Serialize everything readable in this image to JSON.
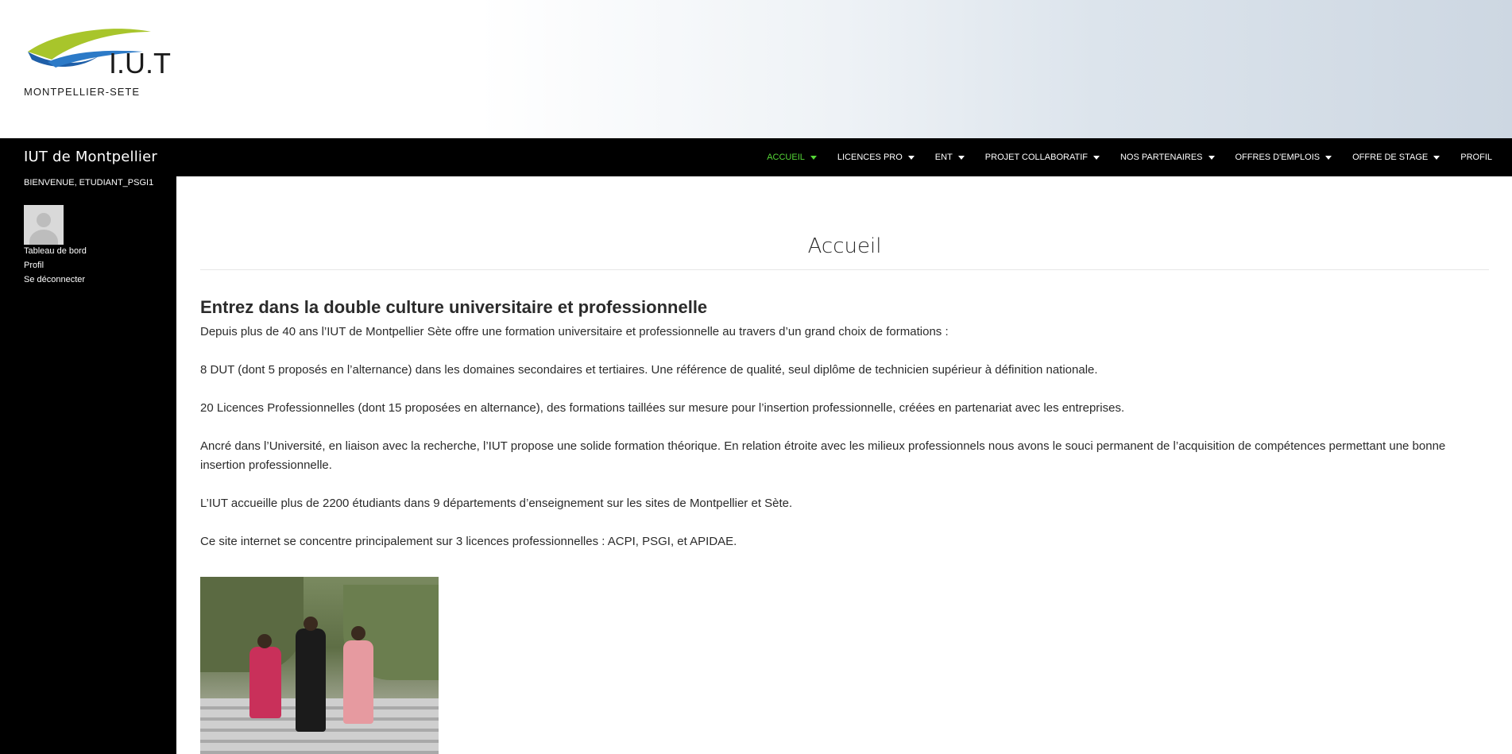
{
  "header": {
    "logo_text": "I.U.T",
    "logo_subtext": "MONTPELLIER-SETE"
  },
  "topbar": {
    "site_title": "IUT de Montpellier",
    "nav": [
      {
        "label": "ACCUEIL",
        "has_caret": true,
        "active": true
      },
      {
        "label": "LICENCES PRO",
        "has_caret": true,
        "active": false
      },
      {
        "label": "ENT",
        "has_caret": true,
        "active": false
      },
      {
        "label": "PROJET COLLABORATIF",
        "has_caret": true,
        "active": false
      },
      {
        "label": "NOS PARTENAIRES",
        "has_caret": true,
        "active": false
      },
      {
        "label": "OFFRES D'EMPLOIS",
        "has_caret": true,
        "active": false
      },
      {
        "label": "OFFRE DE STAGE",
        "has_caret": true,
        "active": false
      },
      {
        "label": "PROFIL",
        "has_caret": false,
        "active": false
      }
    ],
    "active_color": "#55d737"
  },
  "sidebar": {
    "welcome": "BIENVENUE, ETUDIANT_PSGI1",
    "links": [
      "Tableau de bord",
      "Profil",
      "Se déconnecter"
    ]
  },
  "main": {
    "title": "Accueil",
    "heading": "Entrez dans la double culture universitaire et professionnelle",
    "paragraphs": [
      "Depuis plus de 40 ans  l’IUT de Montpellier Sète offre une formation universitaire et professionnelle  au travers d’un grand choix de formations :",
      "8 DUT (dont 5 proposés en l’alternance) dans les domaines secondaires et tertiaires. Une référence de qualité, seul diplôme de technicien supérieur à définition nationale.",
      "20 Licences Professionnelles (dont 15 proposées en alternance), des formations taillées sur mesure pour l’insertion professionnelle, créées en partenariat avec les entreprises.",
      "Ancré dans l’Université, en liaison avec la recherche, l’IUT propose une solide formation théorique. En relation étroite avec les milieux professionnels nous avons le souci permanent  de l’acquisition de compétences permettant une bonne insertion professionnelle.",
      "L’IUT accueille plus de 2200 étudiants dans 9 départements d’enseignement sur les sites de Montpellier et Sète.",
      "Ce site internet se concentre principalement sur 3 licences professionnelles : ACPI, PSGI, et APIDAE."
    ]
  }
}
